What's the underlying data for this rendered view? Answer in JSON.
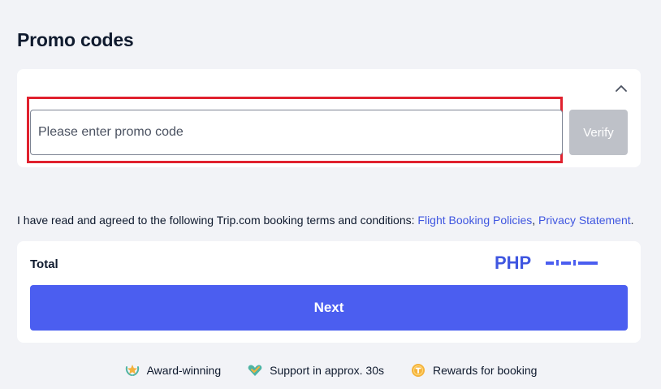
{
  "promo": {
    "title": "Promo codes",
    "input_placeholder": "Please enter promo code",
    "input_value": "",
    "verify_label": "Verify",
    "collapse_icon": "chevron-up-icon"
  },
  "terms": {
    "text": "I have read and agreed to the following Trip.com booking terms and conditions: ",
    "links": [
      "Flight Booking Policies",
      "Privacy Statement"
    ],
    "separator": ", ",
    "end": "."
  },
  "total": {
    "label": "Total",
    "currency": "PHP",
    "amount_masked": true
  },
  "next_label": "Next",
  "features": [
    {
      "icon": "award-laurel-icon",
      "label": "Award-winning"
    },
    {
      "icon": "support-heart-icon",
      "label": "Support in approx. 30s"
    },
    {
      "icon": "reward-coin-icon",
      "label": "Rewards for booking"
    }
  ],
  "colors": {
    "accent": "#4b5ef0",
    "link": "#3f56e0",
    "highlight": "#e0212e",
    "verify_disabled": "#bec1c8",
    "background": "#f2f3f7"
  }
}
